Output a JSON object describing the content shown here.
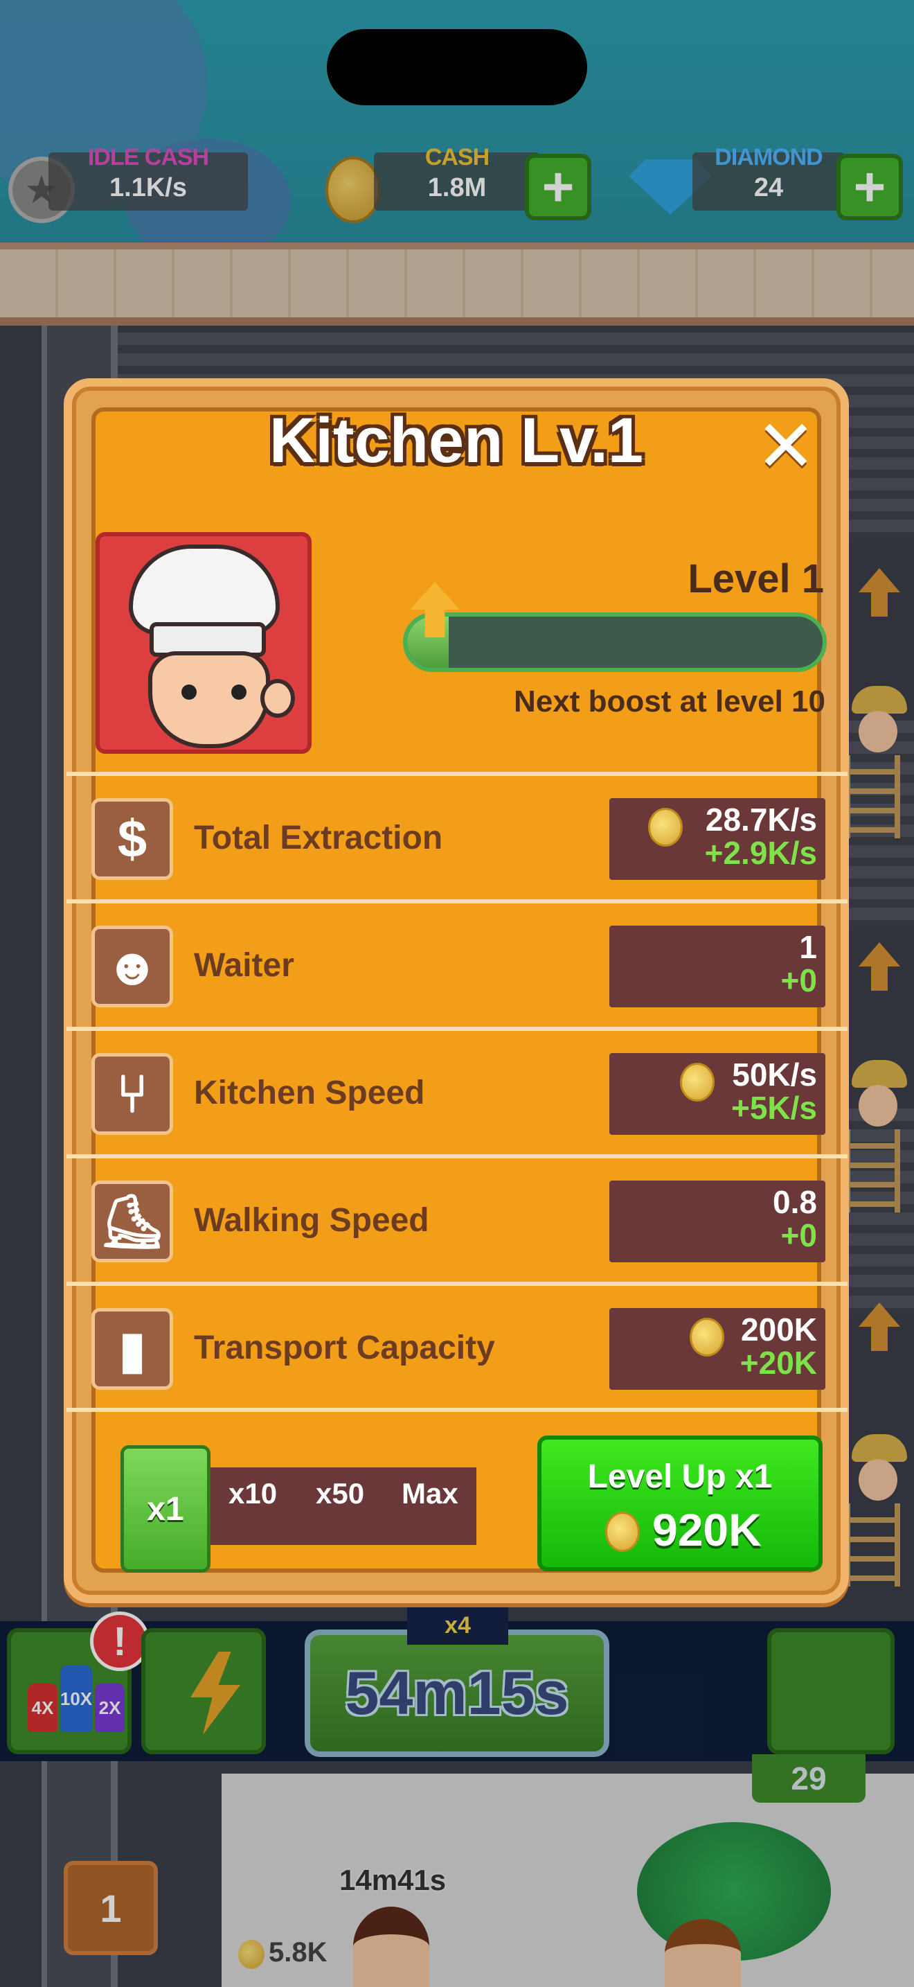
{
  "hud": {
    "idle_cash": {
      "label": "IDLE CASH",
      "value": "1.1K/s",
      "label_color": "#e04fc0"
    },
    "cash": {
      "label": "CASH",
      "value": "1.8M",
      "label_color": "#f2c43a"
    },
    "diamond": {
      "label": "DIAMOND",
      "value": "24",
      "label_color": "#4fb7ff"
    },
    "plus_glyph": "+"
  },
  "modal": {
    "title": "Kitchen Lv.1",
    "close_glyph": "✕",
    "level_label": "Level 1",
    "progress_fraction": 0.1,
    "next_boost": "Next boost at level 10",
    "stats": [
      {
        "icon": "dollar-icon",
        "glyph": "$",
        "label": "Total Extraction",
        "value": "28.7K/s",
        "delta": "+2.9K/s",
        "coin": true
      },
      {
        "icon": "waiter-icon",
        "glyph": "☻",
        "label": "Waiter",
        "value": "1",
        "delta": "+0",
        "coin": false
      },
      {
        "icon": "fork-icon",
        "glyph": "⑂",
        "label": "Kitchen Speed",
        "value": "50K/s",
        "delta": "+5K/s",
        "coin": true
      },
      {
        "icon": "shoe-icon",
        "glyph": "⛸",
        "label": "Walking Speed",
        "value": "0.8",
        "delta": "+0",
        "coin": false
      },
      {
        "icon": "bar-chart-icon",
        "glyph": "▮",
        "label": "Transport Capacity",
        "value": "200K",
        "delta": "+20K",
        "coin": true
      }
    ],
    "multipliers": {
      "active": "x1",
      "options": [
        "x10",
        "x50",
        "Max"
      ]
    },
    "level_up": {
      "label": "Level Up x1",
      "cost": "920K"
    }
  },
  "bottom_bar": {
    "timer": "54m15s",
    "multiplier_badge": "x4",
    "alert": "!",
    "bottle_labels": [
      "4X",
      "10X",
      "2X"
    ],
    "counter": "29"
  },
  "scene": {
    "floor_level": "1",
    "floor_timer": "14m41s",
    "floor_cash": "5.8K"
  },
  "colors": {
    "modal_orange": "#f29e18",
    "stat_box": "#6a3838",
    "delta_green": "#7ee34a",
    "levelup_green": "#14b90a"
  }
}
